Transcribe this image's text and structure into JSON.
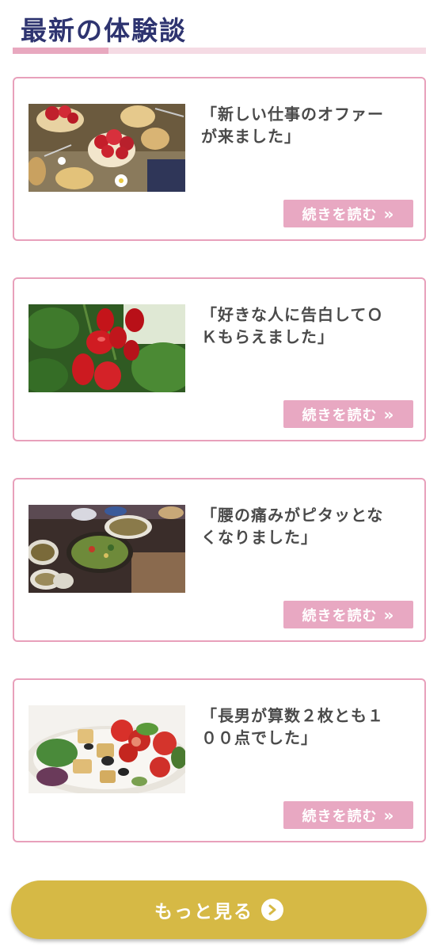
{
  "section": {
    "title": "最新の体験談"
  },
  "cards": [
    {
      "text": "「新しい仕事のオファーが来ました」",
      "image_name": "strawberry-tarts-photo",
      "read_more_label": "続きを読む"
    },
    {
      "text": "「好きな人に告白してＯＫもらえました」",
      "image_name": "tomatoes-on-vine-photo",
      "read_more_label": "続きを読む"
    },
    {
      "text": "「腰の痛みがピタッとなくなりました」",
      "image_name": "salad-bowls-photo",
      "read_more_label": "続きを読む"
    },
    {
      "text": "「長男が算数２枚とも１００点でした」",
      "image_name": "panzanella-salad-photo",
      "read_more_label": "続きを読む"
    }
  ],
  "more_button": {
    "label": "もっと見る",
    "icon": "chevron-right-circle-icon"
  },
  "colors": {
    "title": "#2e3470",
    "card_border": "#e8a0bb",
    "read_more_bg": "#e8a8c2",
    "more_button_bg": "#d6b945",
    "title_bar": "#f5dbe4",
    "title_bar_accent": "#e8a8bf"
  }
}
